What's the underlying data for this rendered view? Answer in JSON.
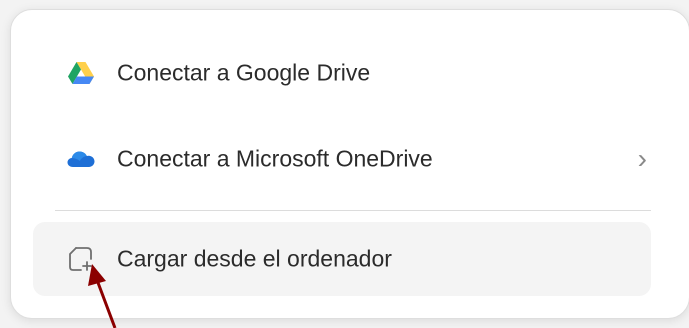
{
  "menu": {
    "items": [
      {
        "label": "Conectar a Google Drive",
        "icon": "google-drive-icon"
      },
      {
        "label": "Conectar a Microsoft OneDrive",
        "icon": "onedrive-icon",
        "submenu": true
      },
      {
        "label": "Cargar desde el ordenador",
        "icon": "upload-from-computer-icon"
      }
    ]
  },
  "colors": {
    "gdrive_green": "#1fa463",
    "gdrive_yellow": "#ffd04b",
    "gdrive_blue": "#4688f4",
    "onedrive_blue": "#1e6fd6",
    "arrow": "#8b0000"
  }
}
